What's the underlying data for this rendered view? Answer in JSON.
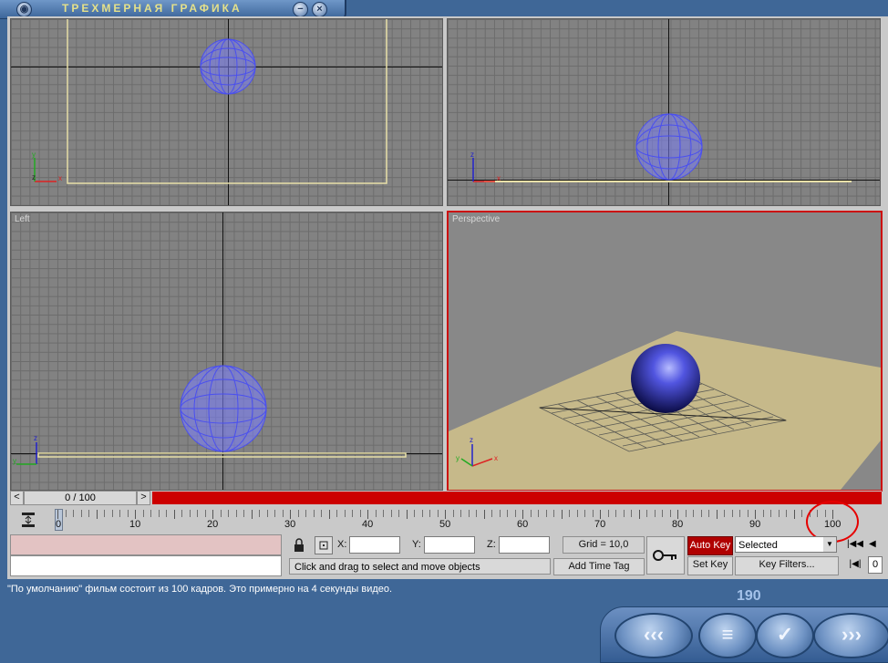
{
  "app": {
    "title": "ТРЕХМЕРНАЯ ГРАФИКА",
    "minimize_glyph": "−",
    "close_glyph": "×"
  },
  "viewports": [
    {
      "id": "top",
      "label": ""
    },
    {
      "id": "front",
      "label": ""
    },
    {
      "id": "left",
      "label": "Left"
    },
    {
      "id": "perspective",
      "label": "Perspective",
      "active": true
    }
  ],
  "axis_labels": {
    "x": "x",
    "y": "y",
    "z": "z"
  },
  "time_slider": {
    "label": "0 / 100",
    "prev_glyph": "<",
    "next_glyph": ">"
  },
  "timeline": {
    "ticks": [
      "10",
      "20",
      "30",
      "40",
      "50",
      "60",
      "70",
      "80",
      "90",
      "100"
    ],
    "start": "0"
  },
  "coords": {
    "x_label": "X:",
    "y_label": "Y:",
    "z_label": "Z:"
  },
  "grid": "Grid = 10,0",
  "prompt": "Click and drag to select and move objects",
  "add_time_tag": "Add Time Tag",
  "auto_key": "Auto Key",
  "set_key": "Set Key",
  "selected": "Selected",
  "key_filters": "Key Filters...",
  "frame_field": "0",
  "status_text": "\"По умолчанию\" фильм состоит из 100 кадров. Это примерно на 4 секунды видео.",
  "page_counter": "190",
  "colors": {
    "accent_red": "#cc0000",
    "wire_blue": "#4a4ff0",
    "floor": "#c6b98a",
    "app_blue": "#3f6797"
  }
}
